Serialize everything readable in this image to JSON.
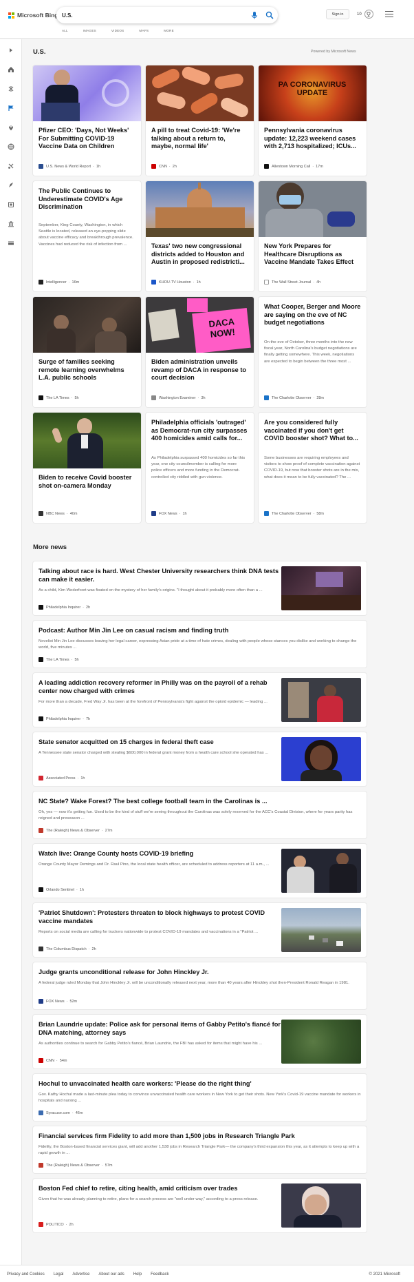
{
  "header": {
    "logo_text": "Microsoft Bing",
    "search_value": "U.S.",
    "tabs": [
      "ALL",
      "IMAGES",
      "VIDEOS",
      "MAPS",
      "MORE"
    ],
    "signin_label": "Sign in",
    "rewards_count": "10"
  },
  "sidebar": {
    "icons": [
      "collapse-arrow-icon",
      "home-icon",
      "sports-icon",
      "flag-icon",
      "location-pin-icon",
      "globe-icon",
      "science-icon",
      "rocket-icon",
      "entertainment-icon",
      "bank-icon",
      "money-icon"
    ]
  },
  "main": {
    "title": "U.S.",
    "powered_by": "Powered by Microsoft News"
  },
  "cards": [
    {
      "title": "Pfizer CEO: 'Days, Not Weeks' For Submitting COVID-19 Vaccine Data on Children",
      "source": "U.S. News & World Report",
      "time": "1h",
      "icon": "usnews-icon",
      "color": "#2a4d8f"
    },
    {
      "title": "A pill to treat Covid-19: 'We're talking about a return to, maybe, normal life'",
      "source": "CNN",
      "time": "2h",
      "icon": "cnn-icon",
      "color": "#cc0000"
    },
    {
      "title": "Pennsylvania coronavirus update: 12,223 weekend cases with 2,713 hospitalized; ICUs...",
      "source": "Allentown Morning Call",
      "time": "17m",
      "icon": "morning-call-icon",
      "color": "#111111",
      "img_text": "PA CORONAVIRUS UPDATE"
    },
    {
      "title": "The Public Continues to Underestimate COVID's Age Discrimination",
      "snippet": "September, King County, Washington, in which Seattle is located, released an eye-popping slide about vaccine efficacy and breakthrough prevalence. Vaccines had reduced the risk of infection from ...",
      "source": "Intelligencer",
      "time": "16m",
      "icon": "intelligencer-icon",
      "color": "#222222"
    },
    {
      "title": "Texas' two new congressional districts added to Houston and Austin in proposed redistricti...",
      "source": "KHOU-TV Houston",
      "time": "1h",
      "icon": "khou-icon",
      "color": "#1b56c9"
    },
    {
      "title": "New York Prepares for Healthcare Disruptions as Vaccine Mandate Takes Effect",
      "source": "The Wall Street Journal",
      "time": "4h",
      "icon": "wsj-icon",
      "color": "#555555"
    },
    {
      "title": "Surge of families seeking remote learning overwhelms L.A. public schools",
      "source": "The LA Times",
      "time": "5h",
      "icon": "latimes-icon",
      "color": "#111111"
    },
    {
      "title": "Biden administration unveils revamp of DACA in response to court decision",
      "source": "Washington Examiner",
      "time": "3h",
      "icon": "examiner-icon",
      "color": "#444444",
      "img_text": "DACA NOW!"
    },
    {
      "title": "What Cooper, Berger and Moore are saying on the eve of NC budget negotiations",
      "snippet": "On the eve of October, three months into the new fiscal year, North Carolina's budget negotiations are finally getting somewhere. This week, negotiations are expected to begin between the three most ...",
      "source": "The Charlotte Observer",
      "time": "28m",
      "icon": "charlotte-observer-icon",
      "color": "#1a73c8"
    },
    {
      "title": "Biden to receive Covid booster shot on-camera Monday",
      "source": "NBC News",
      "time": "40m",
      "icon": "nbc-icon",
      "color": "#333333"
    },
    {
      "title": "Philadelphia officials 'outraged' as Democrat-run city surpasses 400 homicides amid calls for...",
      "snippet": "As Philadelphia surpassed 400 homicides so far this year, one city councilmember is calling for more police officers and more funding in the Democrat-controlled city riddled with gun violence.",
      "source": "FOX News",
      "time": "1h",
      "icon": "fox-icon",
      "color": "#1f3c88"
    },
    {
      "title": "Are you considered fully vaccinated if you don't get COVID booster shot? What to...",
      "snippet": "Some businesses are requiring employees and visitors to show proof of complete vaccination against COVID-19, but now that booster shots are in the mix, what does it mean to be fully vaccinated? The ...",
      "source": "The Charlotte Observer",
      "time": "58m",
      "icon": "charlotte-observer-icon",
      "color": "#1a73c8"
    }
  ],
  "more_news": {
    "title": "More news",
    "items": [
      {
        "title": "Talking about race is hard. West Chester University researchers think DNA tests can make it easier.",
        "snippet": "As a child, Kim Wederfoort was fixated on the mystery of her family's origins. \"I thought about it probably more often than a ...",
        "source": "Philadelphia Inquirer",
        "time": "2h",
        "icon": "inquirer-icon",
        "color": "#111111"
      },
      {
        "title": "Podcast: Author Min Jin Lee on casual racism and finding truth",
        "snippet": "Novelist Min Jin Lee discusses leaving her legal career, expressing Asian pride at a time of hate crimes, dealing with people whose stances you dislike and working to change the world, five minutes ...",
        "source": "The LA Times",
        "time": "5h",
        "icon": "latimes-icon",
        "color": "#111111"
      },
      {
        "title": "A leading addiction recovery reformer in Philly was on the payroll of a rehab center now charged with crimes",
        "snippet": "For more than a decade, Fred Way Jr. has been at the forefront of Pennsylvania's fight against the opioid epidemic — leading ...",
        "source": "Philadelphia Inquirer",
        "time": "7h",
        "icon": "inquirer-icon",
        "color": "#111111"
      },
      {
        "title": "State senator acquitted on 15 charges in federal theft case",
        "snippet": "A Tennessee state senator charged with stealing $600,000 in federal grant money from a health care school she operated has ...",
        "source": "Associated Press",
        "time": "1h",
        "icon": "ap-icon",
        "color": "#d22630"
      },
      {
        "title": "NC State? Wake Forest? The best college football team in the Carolinas is ...",
        "snippet": "Oh, yes — now it's getting fun. Used to be the kind of stuff we're seeing throughout the Carolinas was solely reserved for the ACC's Coastal Division, where for years parity has reigned and preseason ...",
        "source": "The (Raleigh) News & Observer",
        "time": "27m",
        "icon": "news-observer-icon",
        "color": "#c0392b"
      },
      {
        "title": "Watch live: Orange County hosts COVID-19 briefing",
        "snippet": "Orange County Mayor Demings and Dr. Raul Pino, the local state health officer, are scheduled to address reporters at 11 a.m., ...",
        "source": "Orlando Sentinel",
        "time": "1h",
        "icon": "sentinel-icon",
        "color": "#111111"
      },
      {
        "title": "'Patriot Shutdown': Protesters threaten to block highways to protest COVID vaccine mandates",
        "snippet": "Reports on social media are calling for truckers nationwide to protest COVID-19 mandates and vaccinations in a \"Patriot ...",
        "source": "The Columbus Dispatch",
        "time": "2h",
        "icon": "dispatch-icon",
        "color": "#333333"
      },
      {
        "title": "Judge grants unconditional release for John Hinckley Jr.",
        "snippet": "A federal judge ruled Monday that John Hinckley Jr. will be unconditionally released next year, more than 40 years after Hinckley shot then-President Ronald Reagan in 1981.",
        "source": "FOX News",
        "time": "52m",
        "icon": "fox-icon",
        "color": "#1f3c88"
      },
      {
        "title": "Brian Laundrie update: Police ask for personal items of Gabby Petito's fiancé for DNA matching, attorney says",
        "snippet": "As authorities continue to search for Gabby Petito's fiancé, Brian Laundrie, the FBI has asked for items that might have his ...",
        "source": "CNN",
        "time": "54m",
        "icon": "cnn-icon",
        "color": "#cc0000"
      },
      {
        "title": "Hochul to unvaccinated health care workers: 'Please do the right thing'",
        "snippet": "Gov. Kathy Hochul made a last-minute plea today to convince unvaccinated health care workers in New York to get their shots. New York's Covid-19 vaccine mandate for workers in hospitals and nursing ...",
        "source": "Syracuse.com",
        "time": "46m",
        "icon": "syracuse-icon",
        "color": "#3b6bb0"
      },
      {
        "title": "Financial services firm Fidelity to add more than 1,500 jobs in Research Triangle Park",
        "snippet": "Fidelity, the Boston-based financial services giant, will add another 1,538 jobs in Research Triangle Park— the company's third expansion this year, as it attempts to keep up with a rapid growth in ...",
        "source": "The (Raleigh) News & Observer",
        "time": "57m",
        "icon": "news-observer-icon",
        "color": "#c0392b"
      },
      {
        "title": "Boston Fed chief to retire, citing health, amid criticism over trades",
        "snippet": "Given that he was already planning to retire, plans for a search process are \"well under way,\" according to a press release.",
        "source": "POLITICO",
        "time": "2h",
        "icon": "politico-icon",
        "color": "#d81e1e"
      }
    ]
  },
  "footer": {
    "links": [
      "Privacy and Cookies",
      "Legal",
      "Advertise",
      "About our ads",
      "Help",
      "Feedback"
    ],
    "copyright": "© 2021 Microsoft"
  }
}
